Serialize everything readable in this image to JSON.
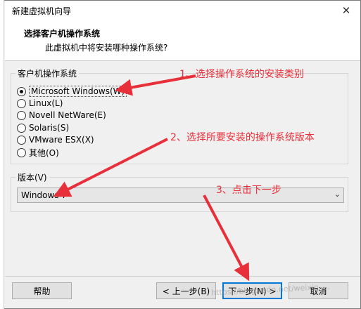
{
  "window": {
    "title": "新建虚拟机向导",
    "close_glyph": "✕"
  },
  "header": {
    "title": "选择客户机操作系统",
    "subtitle": "此虚拟机中将安装哪种操作系统?"
  },
  "os_group": {
    "label": "客户机操作系统",
    "options": [
      {
        "label": "Microsoft Windows(W)",
        "checked": true
      },
      {
        "label": "Linux(L)",
        "checked": false
      },
      {
        "label": "Novell NetWare(E)",
        "checked": false
      },
      {
        "label": "Solaris(S)",
        "checked": false
      },
      {
        "label": "VMware ESX(X)",
        "checked": false
      },
      {
        "label": "其他(O)",
        "checked": false
      }
    ]
  },
  "version_group": {
    "label": "版本(V)",
    "selected": "Windows 7",
    "arrow_glyph": "⌄"
  },
  "buttons": {
    "help": "帮助",
    "back": "< 上一步(B)",
    "next": "下一步(N) >",
    "cancel": "取消"
  },
  "annotations": {
    "note1": "1、选择操作系统的安装类别",
    "note2": "2、选择所要安装的操作系统版本",
    "note3": "3、点击下一步",
    "color": "#e8303a"
  },
  "watermark": "https://blog.csdn.net/weixin_..."
}
